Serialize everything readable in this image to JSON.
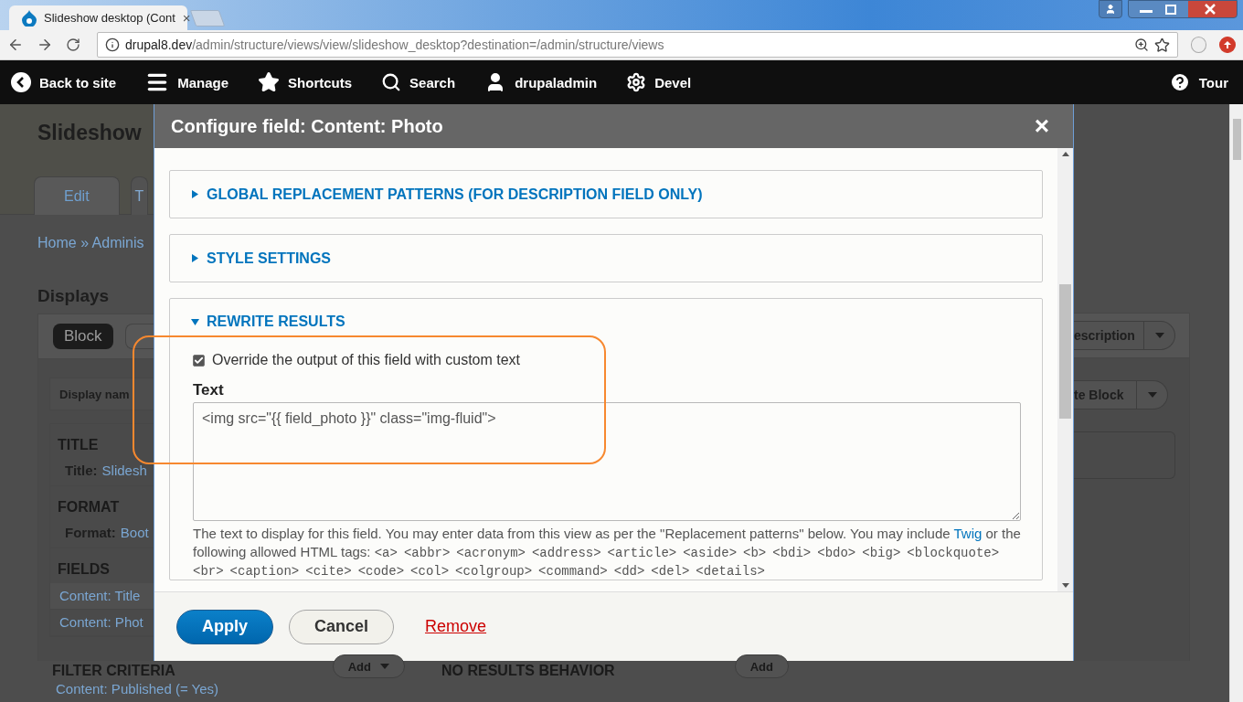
{
  "browser": {
    "tab_title": "Slideshow desktop (Cont",
    "tab_close": "×",
    "url_host": "drupal8.dev",
    "url_path": "/admin/structure/views/view/slideshow_desktop?destination=/admin/structure/views"
  },
  "toolbar": {
    "items": [
      {
        "kind": "back",
        "label": "Back to site"
      },
      {
        "kind": "manage",
        "label": "Manage"
      },
      {
        "kind": "shortcuts",
        "label": "Shortcuts"
      },
      {
        "kind": "search",
        "label": "Search"
      },
      {
        "kind": "user",
        "label": "drupaladmin"
      },
      {
        "kind": "devel",
        "label": "Devel"
      }
    ],
    "tour": "Tour"
  },
  "page": {
    "title": "Slideshow",
    "tabs": [
      {
        "label": "Edit",
        "selected": true
      },
      {
        "label": "T",
        "selected": false
      }
    ],
    "breadcrumb": "Home » Adminis",
    "displays_heading": "Displays",
    "display_button": "Block",
    "display_name_label": "Display nam",
    "sections": [
      {
        "heading": "TITLE",
        "rows": [
          {
            "kind": "setting",
            "label": "Title:",
            "value": "Slidesh"
          }
        ]
      },
      {
        "heading": "FORMAT",
        "rows": [
          {
            "kind": "setting",
            "label": "Format:",
            "value": "Boot"
          }
        ]
      },
      {
        "heading": "FIELDS",
        "rows": [
          {
            "kind": "link",
            "value": "Content: Title"
          },
          {
            "kind": "link",
            "value": "Content: Phot"
          }
        ]
      }
    ],
    "right_buttons": [
      "escription",
      "te Block"
    ],
    "filter": {
      "heading": "FILTER CRITERIA",
      "add": "Add",
      "rows": [
        "Content: Published (= Yes)"
      ]
    },
    "no_results": {
      "heading": "NO RESULTS BEHAVIOR",
      "add": "Add"
    }
  },
  "dialog": {
    "title": "Configure field: Content: Photo",
    "close": "×",
    "sections": [
      {
        "label": "GLOBAL REPLACEMENT PATTERNS (FOR DESCRIPTION FIELD ONLY)",
        "expanded": false
      },
      {
        "label": "STYLE SETTINGS",
        "expanded": false
      },
      {
        "label": "REWRITE RESULTS",
        "expanded": true
      }
    ],
    "override": {
      "label": "Override the output of this field with custom text",
      "checked": true
    },
    "text_label": "Text",
    "text_value": "<img src=\"{{ field_photo }}\" class=\"img-fluid\">",
    "description": {
      "before": "The text to display for this field. You may enter data from this view as per the \"Replacement patterns\" below. You may include ",
      "link": "Twig",
      "after": " or the following allowed HTML tags:",
      "tags": [
        "<a>",
        "<abbr>",
        "<acronym>",
        "<address>",
        "<article>",
        "<aside>",
        "<b>",
        "<bdi>",
        "<bdo>",
        "<big>",
        "<blockquote>",
        "<br>",
        "<caption>",
        "<cite>",
        "<code>",
        "<col>",
        "<colgroup>",
        "<command>",
        "<dd>",
        "<del>",
        "<details>"
      ]
    },
    "buttons": [
      {
        "kind": "primary",
        "label": "Apply"
      },
      {
        "kind": "secondary",
        "label": "Cancel"
      },
      {
        "kind": "link",
        "label": "Remove"
      }
    ]
  }
}
